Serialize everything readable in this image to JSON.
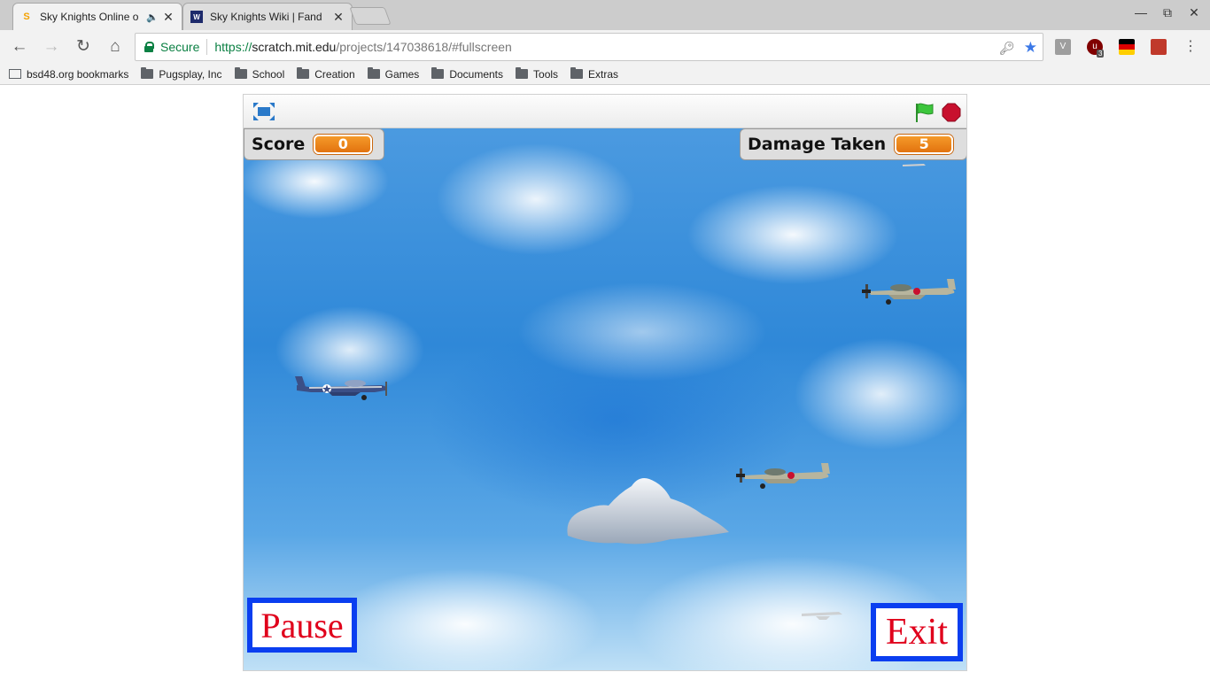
{
  "browser": {
    "tabs": [
      {
        "title": "Sky Knights Online o",
        "favicon": "scratch-cat-icon",
        "active": true
      },
      {
        "title": "Sky Knights Wiki | Fand",
        "favicon": "fandom-icon",
        "active": false
      }
    ],
    "omnibox": {
      "secure_label": "Secure",
      "url_scheme": "https://",
      "url_host": "scratch.mit.edu",
      "url_path": "/projects/147038618/#fullscreen"
    },
    "extension_badge": "3",
    "bookmarks": [
      {
        "label": "bsd48.org bookmarks",
        "icon": "apps-icon"
      },
      {
        "label": "Pugsplay, Inc",
        "icon": "folder-icon"
      },
      {
        "label": "School",
        "icon": "folder-icon"
      },
      {
        "label": "Creation",
        "icon": "folder-icon"
      },
      {
        "label": "Games",
        "icon": "folder-icon"
      },
      {
        "label": "Documents",
        "icon": "folder-icon"
      },
      {
        "label": "Tools",
        "icon": "folder-icon"
      },
      {
        "label": "Extras",
        "icon": "folder-icon"
      }
    ]
  },
  "game": {
    "score_label": "Score",
    "score_value": "0",
    "damage_label": "Damage Taken",
    "damage_value": "5",
    "pause_label": "Pause",
    "exit_label": "Exit"
  },
  "colors": {
    "monitor_orange": "#e8821a",
    "button_border_blue": "#0a3ef0",
    "button_text_red": "#e0001b",
    "flag_green": "#2fb52f",
    "stop_red": "#c8102e"
  }
}
